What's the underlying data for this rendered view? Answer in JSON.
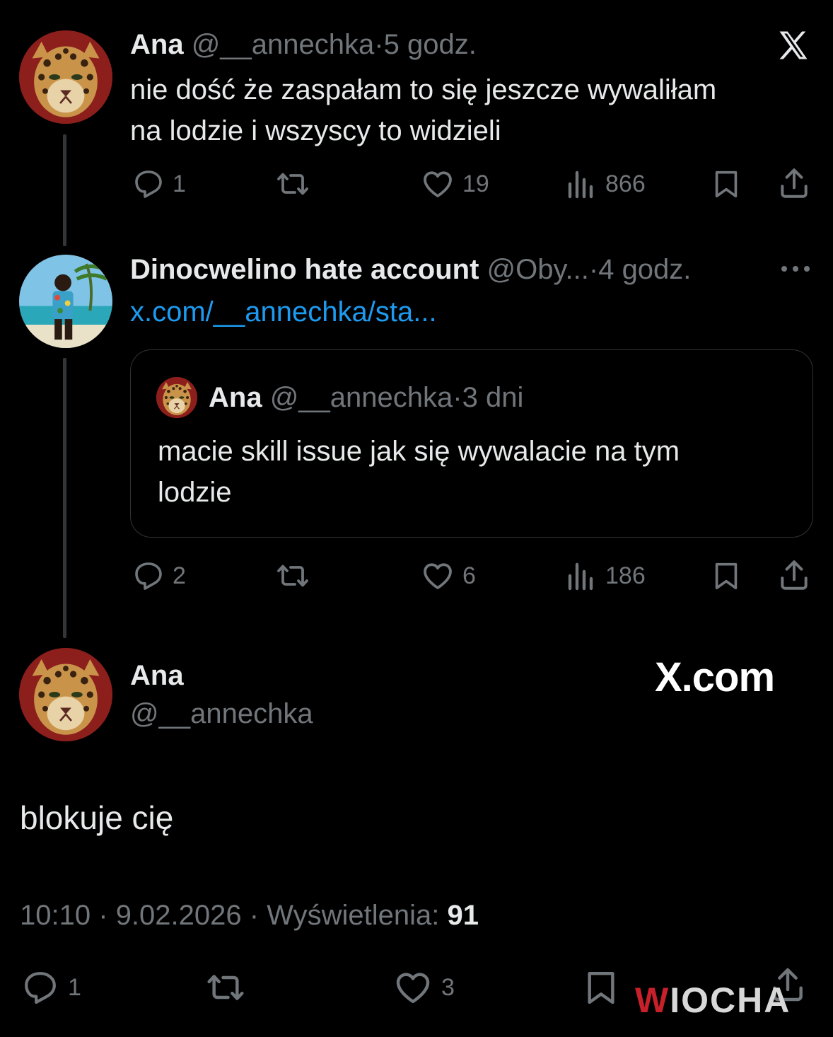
{
  "tweet1": {
    "name": "Ana",
    "handle": "@__annechka",
    "time": "5 godz.",
    "text_line1": "nie dość że zaspałam to się jeszcze wywaliłam",
    "text_line2": "na lodzie i wszyscy to widzieli",
    "replies": "1",
    "likes": "19",
    "views": "866"
  },
  "tweet2": {
    "name": "Dinocwelino hate account",
    "handle": "@Oby...",
    "time": "4 godz.",
    "link": "x.com/__annechka/sta...",
    "quote": {
      "name": "Ana",
      "handle": "@__annechka",
      "time": "3 dni",
      "text_line1": "macie skill issue jak się wywalacie na tym",
      "text_line2": "lodzie"
    },
    "replies": "2",
    "likes": "6",
    "views": "186"
  },
  "main": {
    "name": "Ana",
    "handle": "@__annechka",
    "text": "blokuje cię",
    "time": "10:10",
    "date": "9.02.2026",
    "views_label": "Wyświetlenia:",
    "views": "91",
    "replies": "1",
    "likes": "3"
  },
  "branding": {
    "x_com": "X.com",
    "watermark": "WIOCHA"
  },
  "separator": "·",
  "icons": [
    "x-logo-icon",
    "reply-icon",
    "retweet-icon",
    "like-icon",
    "views-icon",
    "bookmark-icon",
    "share-icon",
    "more-icon"
  ],
  "colors": {
    "background": "#000000",
    "text": "#e7e9ea",
    "muted": "#71767b",
    "link": "#1d9bf0",
    "watermark_red": "#c8202a"
  }
}
